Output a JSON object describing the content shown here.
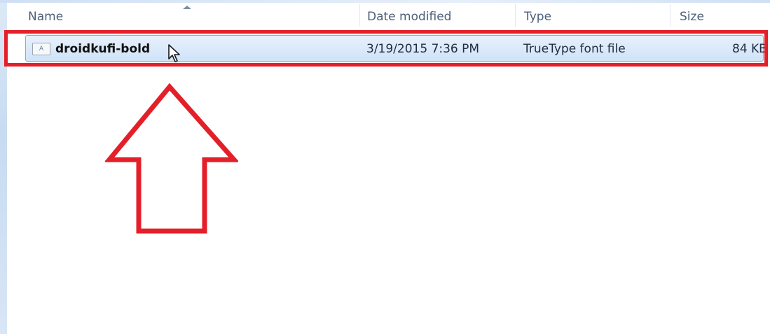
{
  "columns": {
    "name": "Name",
    "date_modified": "Date modified",
    "type": "Type",
    "size": "Size"
  },
  "file": {
    "icon": "font-file-icon",
    "icon_glyph": "A",
    "name": "droidkufi-bold",
    "date_modified": "3/19/2015 7:36 PM",
    "type": "TrueType font file",
    "size": "84 KB"
  },
  "annotation": {
    "highlight_color": "#e3202a",
    "arrow": "up-arrow"
  },
  "colors": {
    "selection_fill": "#d0e3f8",
    "selection_border": "#84acdd",
    "header_text": "#4c607a"
  }
}
